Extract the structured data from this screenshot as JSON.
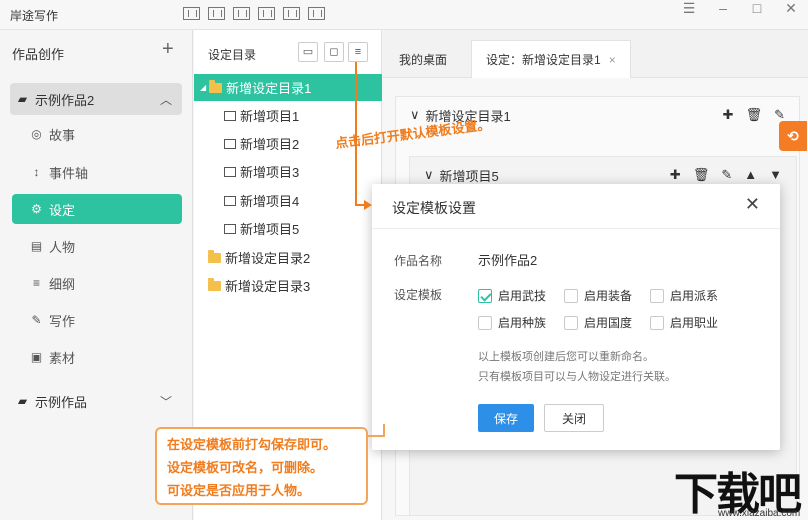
{
  "app": {
    "title": "岸途写作"
  },
  "window_controls": {
    "menu": "☰",
    "minimize": "–",
    "maximize": "□",
    "close": "✕"
  },
  "sidebar": {
    "header": "作品创作",
    "add": "+",
    "works": [
      {
        "label": "示例作品2",
        "expanded": true
      },
      {
        "label": "示例作品",
        "expanded": false
      }
    ],
    "nav": [
      {
        "label": "故事",
        "icon": "globe-icon"
      },
      {
        "label": "事件轴",
        "icon": "sort-icon"
      },
      {
        "label": "设定",
        "icon": "gears-icon",
        "selected": true
      },
      {
        "label": "人物",
        "icon": "id-card-icon"
      },
      {
        "label": "细纲",
        "icon": "lines-icon"
      },
      {
        "label": "写作",
        "icon": "pencil-icon"
      },
      {
        "label": "素材",
        "icon": "image-icon"
      }
    ]
  },
  "tree": {
    "header": "设定目录",
    "items": [
      {
        "label": "新增设定目录1",
        "type": "folder",
        "selected": true
      },
      {
        "label": "新增项目1",
        "type": "doc"
      },
      {
        "label": "新增项目2",
        "type": "doc"
      },
      {
        "label": "新增项目3",
        "type": "doc"
      },
      {
        "label": "新增项目4",
        "type": "doc"
      },
      {
        "label": "新增项目5",
        "type": "doc"
      },
      {
        "label": "新增设定目录2",
        "type": "folder"
      },
      {
        "label": "新增设定目录3",
        "type": "folder"
      }
    ]
  },
  "tabs": [
    {
      "label": "我的桌面"
    },
    {
      "label": "设定：新增设定目录1",
      "active": true,
      "close": "×"
    }
  ],
  "content": {
    "card1": {
      "title": "新增设定目录1"
    },
    "card2": {
      "title": "新增项目5"
    }
  },
  "side_badge": "⟲",
  "modal": {
    "title": "设定模板设置",
    "close": "✕",
    "name_label": "作品名称",
    "name_value": "示例作品2",
    "template_label": "设定模板",
    "templates": [
      {
        "label": "启用武技",
        "checked": true
      },
      {
        "label": "启用装备",
        "checked": false
      },
      {
        "label": "启用派系",
        "checked": false
      },
      {
        "label": "启用种族",
        "checked": false
      },
      {
        "label": "启用国度",
        "checked": false
      },
      {
        "label": "启用职业",
        "checked": false
      }
    ],
    "note1": "以上模板项创建后您可以重新命名。",
    "note2": "只有模板项目可以与人物设定进行关联。",
    "save": "保存",
    "cancel": "关闭"
  },
  "annotations": {
    "top": "点击后打开默认模板设置。",
    "callout": [
      "在设定模板前打勾保存即可。",
      "设定模板可改名，可删除。",
      "可设定是否应用于人物。"
    ],
    "accent": "#f07c1d"
  },
  "watermark": {
    "main": "下载吧",
    "sub": "www.xiazaiba.com"
  }
}
